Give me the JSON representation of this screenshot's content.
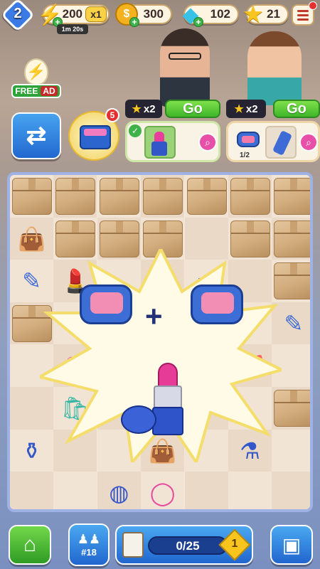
{
  "top": {
    "level": "2",
    "energy": "200",
    "multiplier": "x1",
    "energy_timer": "1m 20s",
    "coins": "300",
    "gems": "102",
    "stars": "21"
  },
  "ad": {
    "free": "FREE",
    "ad": "AD"
  },
  "inventory_badge": "5",
  "orders": [
    {
      "reward": "x2",
      "go": "Go",
      "progress": ""
    },
    {
      "reward": "x2",
      "go": "Go",
      "progress": "1/2"
    }
  ],
  "bottom": {
    "level_badge": "#18",
    "progress": "0/25",
    "progress_fraction": 0,
    "task_level": "1"
  },
  "colors": {
    "accent": "#2f6bd8",
    "go_green": "#3fb62a",
    "star": "#f7c51e"
  }
}
